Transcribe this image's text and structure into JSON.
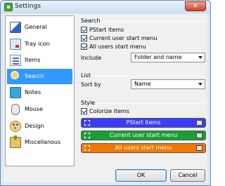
{
  "window": {
    "title": "Settings",
    "close_label": "✕"
  },
  "nav": {
    "items": [
      {
        "label": "General",
        "icon": "general-icon",
        "selected": false
      },
      {
        "label": "Tray icon",
        "icon": "tray-icon",
        "selected": false
      },
      {
        "label": "Items",
        "icon": "items-icon",
        "selected": false
      },
      {
        "label": "Search",
        "icon": "search-icon",
        "selected": true
      },
      {
        "label": "Notes",
        "icon": "notes-icon",
        "selected": false
      },
      {
        "label": "Mouse",
        "icon": "mouse-icon",
        "selected": false
      },
      {
        "label": "Design",
        "icon": "design-icon",
        "selected": false
      },
      {
        "label": "Miscellanous",
        "icon": "miscellanous-icon",
        "selected": false
      }
    ]
  },
  "search_group": {
    "title": "Search",
    "options": [
      {
        "label": "PStart items",
        "checked": true
      },
      {
        "label": "Current user start menu",
        "checked": true
      },
      {
        "label": "All users start menu",
        "checked": true
      }
    ],
    "include_label": "Include",
    "include_value": "Folder and name"
  },
  "list_group": {
    "title": "List",
    "sort_label": "Sort by",
    "sort_value": "Name"
  },
  "style_group": {
    "title": "Style",
    "colorize_label": "Colorize items",
    "colorize_checked": true,
    "bars": [
      {
        "label": "PStart items",
        "color": "#3b3bff"
      },
      {
        "label": "Current user start menu",
        "color": "#18a035"
      },
      {
        "label": "All users start menu",
        "color": "#f07800"
      }
    ]
  },
  "buttons": {
    "ok": "OK",
    "cancel": "Cancel"
  },
  "colors": {
    "selection": "#3399ff",
    "window_frame": "#dde8f4",
    "close": "#c8412a"
  }
}
